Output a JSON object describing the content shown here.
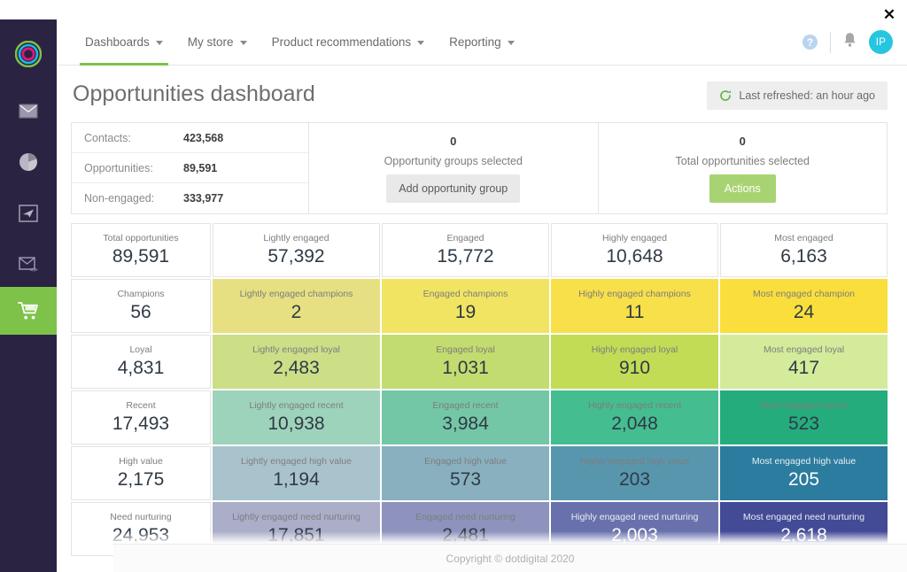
{
  "window": {
    "close_label": "✕"
  },
  "sidebar": {
    "logo": "dotdigital-target-logo",
    "items": [
      {
        "name": "email-icon",
        "label": "Email"
      },
      {
        "name": "analytics-pie-icon",
        "label": "Analytics"
      },
      {
        "name": "campaign-frame-icon",
        "label": "Campaigns"
      },
      {
        "name": "email-code-icon",
        "label": "Transactional"
      },
      {
        "name": "commerce-cart-icon",
        "label": "Commerce",
        "active": true
      }
    ]
  },
  "topnav": {
    "items": [
      {
        "label": "Dashboards",
        "caret": true,
        "active": true
      },
      {
        "label": "My store",
        "caret": true,
        "active": false
      },
      {
        "label": "Product recommendations",
        "caret": true,
        "active": false
      },
      {
        "label": "Reporting",
        "caret": true,
        "active": false
      }
    ],
    "help_label": "?",
    "avatar_initials": "IP"
  },
  "page": {
    "title": "Opportunities dashboard",
    "refresh_text": "Last refreshed: an hour ago"
  },
  "summary": {
    "stats": [
      {
        "label": "Contacts:",
        "value": "423,568"
      },
      {
        "label": "Opportunities:",
        "value": "89,591"
      },
      {
        "label": "Non-engaged:",
        "value": "333,977"
      }
    ],
    "groups_panel": {
      "count": "0",
      "caption": "Opportunity groups selected",
      "button": "Add opportunity group"
    },
    "totals_panel": {
      "count": "0",
      "caption": "Total opportunities selected",
      "button": "Actions"
    }
  },
  "chart_data": {
    "type": "heatmap",
    "title": "Opportunities dashboard",
    "columns": [
      "Total",
      "Lightly engaged",
      "Engaged",
      "Highly engaged",
      "Most engaged"
    ],
    "rows": [
      {
        "name": "total",
        "cells": [
          {
            "label": "Total opportunities",
            "value": "89,591",
            "bg": "#ffffff",
            "light": false
          },
          {
            "label": "Lightly engaged",
            "value": "57,392",
            "bg": "#ffffff",
            "light": false
          },
          {
            "label": "Engaged",
            "value": "15,772",
            "bg": "#ffffff",
            "light": false
          },
          {
            "label": "Highly engaged",
            "value": "10,648",
            "bg": "#ffffff",
            "light": false
          },
          {
            "label": "Most engaged",
            "value": "6,163",
            "bg": "#ffffff",
            "light": false
          }
        ]
      },
      {
        "name": "champions",
        "cells": [
          {
            "label": "Champions",
            "value": "56",
            "bg": "#ffffff",
            "light": false
          },
          {
            "label": "Lightly engaged champions",
            "value": "2",
            "bg": "#e6e083",
            "light": false
          },
          {
            "label": "Engaged champions",
            "value": "19",
            "bg": "#f2e463",
            "light": false
          },
          {
            "label": "Highly engaged champions",
            "value": "11",
            "bg": "#f7e04a",
            "light": false
          },
          {
            "label": "Most engaged champion",
            "value": "24",
            "bg": "#fadf3c",
            "light": false
          }
        ]
      },
      {
        "name": "loyal",
        "cells": [
          {
            "label": "Loyal",
            "value": "4,831",
            "bg": "#ffffff",
            "light": false
          },
          {
            "label": "Lightly engaged loyal",
            "value": "2,483",
            "bg": "#ccdf87",
            "light": false
          },
          {
            "label": "Engaged loyal",
            "value": "1,031",
            "bg": "#c3dc6f",
            "light": false
          },
          {
            "label": "Highly engaged loyal",
            "value": "910",
            "bg": "#c2dc55",
            "light": false
          },
          {
            "label": "Most engaged loyal",
            "value": "417",
            "bg": "#d3eb9b",
            "light": false
          }
        ]
      },
      {
        "name": "recent",
        "cells": [
          {
            "label": "Recent",
            "value": "17,493",
            "bg": "#ffffff",
            "light": false
          },
          {
            "label": "Lightly engaged recent",
            "value": "10,938",
            "bg": "#9ed3bb",
            "light": false
          },
          {
            "label": "Engaged recent",
            "value": "3,984",
            "bg": "#73c7a6",
            "light": false
          },
          {
            "label": "Highly engaged recent",
            "value": "2,048",
            "bg": "#44bd90",
            "light": false
          },
          {
            "label": "Most engaged recent",
            "value": "523",
            "bg": "#25ac7d",
            "light": false
          }
        ]
      },
      {
        "name": "high-value",
        "cells": [
          {
            "label": "High value",
            "value": "2,175",
            "bg": "#ffffff",
            "light": false
          },
          {
            "label": "Lightly engaged high value",
            "value": "1,194",
            "bg": "#a9c3cd",
            "light": false
          },
          {
            "label": "Engaged high value",
            "value": "573",
            "bg": "#88b0bf",
            "light": false
          },
          {
            "label": "Highly engaged high value",
            "value": "203",
            "bg": "#5896ae",
            "light": false
          },
          {
            "label": "Most engaged high value",
            "value": "205",
            "bg": "#2b7c9e",
            "light": true
          }
        ]
      },
      {
        "name": "need-nurturing",
        "cells": [
          {
            "label": "Need nurturing",
            "value": "24,953",
            "bg": "#ffffff",
            "light": false
          },
          {
            "label": "Lightly engaged need nurturing",
            "value": "17,851",
            "bg": "#aaaec9",
            "light": false
          },
          {
            "label": "Engaged need nurturing",
            "value": "2,481",
            "bg": "#8d93bd",
            "light": false
          },
          {
            "label": "Highly engaged need nurturing",
            "value": "2,003",
            "bg": "#6971ad",
            "light": true
          },
          {
            "label": "Most engaged need nurturing",
            "value": "2,618",
            "bg": "#434a96",
            "light": true
          }
        ]
      }
    ]
  },
  "footer": {
    "copyright": "Copyright © dotdigital 2020"
  },
  "colors": {
    "rail_bg": "#2b2342",
    "accent_green": "#7ec24a",
    "avatar_cyan": "#26c6e0"
  }
}
